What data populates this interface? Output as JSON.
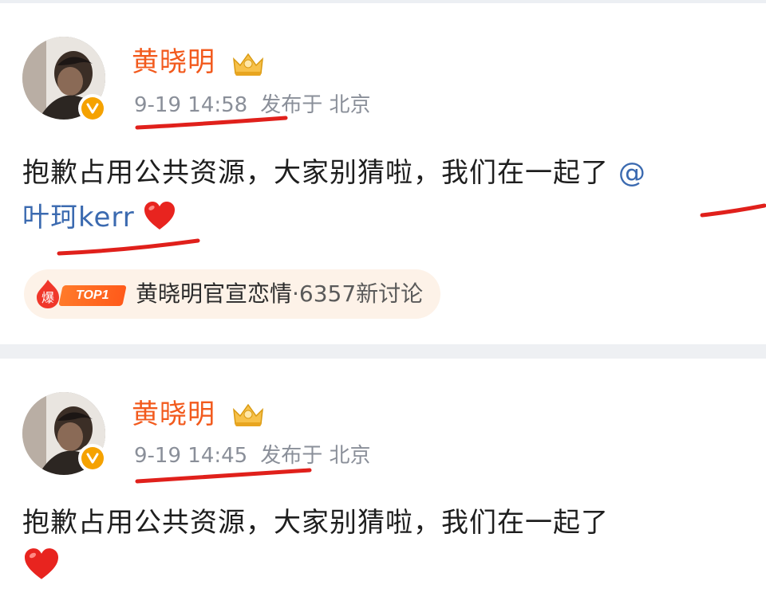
{
  "posts": [
    {
      "username": "黄晓明",
      "time": "9-19 14:58",
      "location": "发布于 北京",
      "content_text": "抱歉占用公共资源，大家别猜啦，我们在一起了",
      "mention_at": "@",
      "mention_name": "叶珂kerr",
      "emoji": "red-heart",
      "hot_topic": {
        "fire_badge": "爆",
        "rank_badge": "TOP1",
        "title": "黄晓明官宣恋情",
        "discussion": "·6357新讨论"
      }
    },
    {
      "username": "黄晓明",
      "time": "9-19 14:45",
      "location": "发布于 北京",
      "content_text": "抱歉占用公共资源，大家别猜啦，我们在一起了",
      "emoji": "red-heart"
    }
  ],
  "icons": {
    "verified": "verified-v-icon",
    "crown": "crown-icon",
    "heart": "heart-icon"
  },
  "colors": {
    "username": "#f25a1d",
    "meta": "#8a8f99",
    "mention": "#3b6ab0",
    "annotation_red": "#e0201b",
    "verified_badge": "#f5a200",
    "topic_pill_bg": "#fdf2e8"
  }
}
